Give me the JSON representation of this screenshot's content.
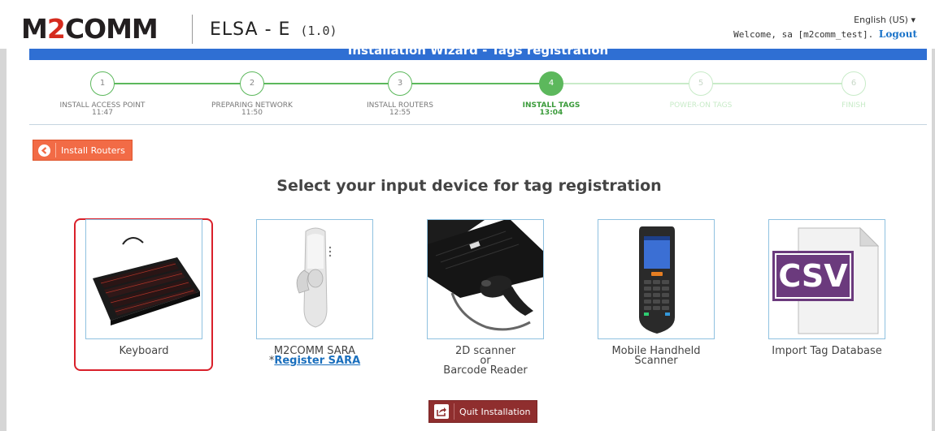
{
  "header": {
    "logo_prefix": "M",
    "logo_two": "2",
    "logo_suffix": "COMM",
    "app_title": "ELSA - E",
    "app_version": "(1.0)",
    "language": "English (US) ▾",
    "welcome_text": "Welcome, sa [m2comm_test].",
    "logout_label": "Logout"
  },
  "wizard": {
    "banner_title": "Installation Wizard - Tags registration",
    "steps": [
      {
        "number": "1",
        "label": "INSTALL ACCESS POINT",
        "time": "11:47",
        "state": "done"
      },
      {
        "number": "2",
        "label": "PREPARING NETWORK",
        "time": "11:50",
        "state": "done"
      },
      {
        "number": "3",
        "label": "INSTALL ROUTERS",
        "time": "12:55",
        "state": "done"
      },
      {
        "number": "4",
        "label": "INSTALL TAGS",
        "time": "13:04",
        "state": "active"
      },
      {
        "number": "5",
        "label": "POWER-ON TAGS",
        "time": "",
        "state": "future"
      },
      {
        "number": "6",
        "label": "FINISH",
        "time": "",
        "state": "future"
      }
    ]
  },
  "back_button": {
    "label": "Install Routers",
    "icon": "arrow-left-circle-icon"
  },
  "heading": "Select your input device for tag registration",
  "devices": [
    {
      "label": "Keyboard",
      "selected": true
    },
    {
      "label": "M2COMM SARA",
      "sub_prefix": "*",
      "link": "Register SARA"
    },
    {
      "label": "2D scanner",
      "line2": "or",
      "line3": "Barcode Reader"
    },
    {
      "label": "Mobile Handheld",
      "line2": "Scanner"
    },
    {
      "label": "Import Tag Database",
      "csv_text": "CSV"
    }
  ],
  "quit_button": {
    "label": "Quit Installation",
    "icon": "share-exit-icon"
  },
  "colors": {
    "banner": "#2f6fd3",
    "step_green": "#5cb85c",
    "back_button": "#f26b46",
    "quit_button": "#8f2e2e",
    "selected_ring": "#d9202a",
    "logo_accent": "#d52b1e"
  }
}
